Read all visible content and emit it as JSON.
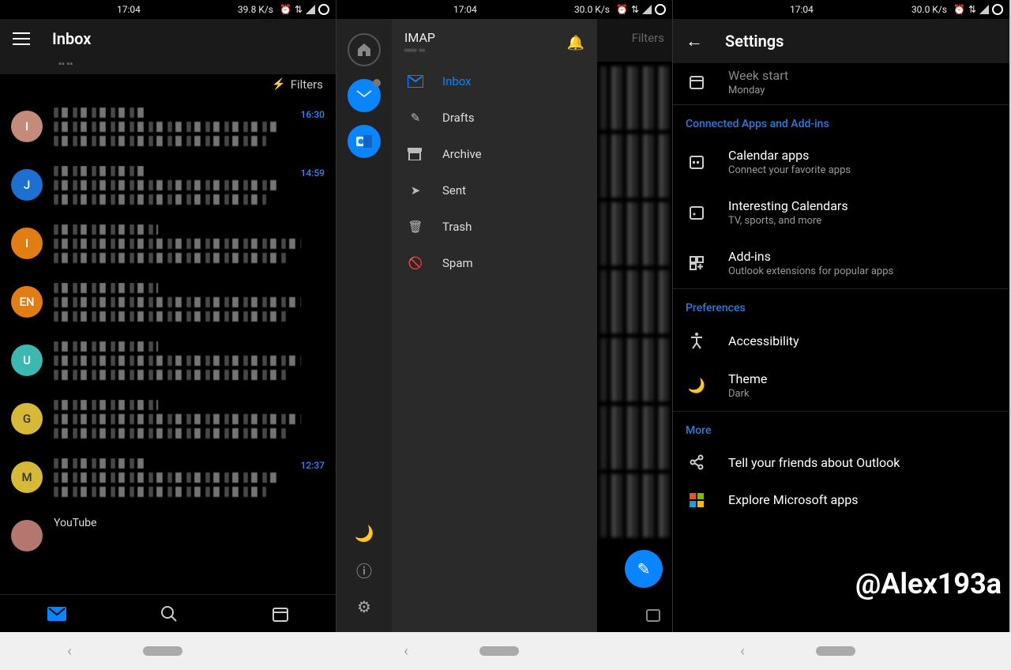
{
  "statusbars": [
    {
      "time": "17:04",
      "speed": "39.8 K/s"
    },
    {
      "time": "17:04",
      "speed": "30.0 K/s"
    },
    {
      "time": "17:04",
      "speed": "30.0 K/s"
    }
  ],
  "screen1": {
    "title": "Inbox",
    "filters_label": "Filters",
    "messages": [
      {
        "avatar": "I",
        "color": "#c48b7a",
        "time": "16:30"
      },
      {
        "avatar": "J",
        "color": "#1d6fd1",
        "time": "14:59"
      },
      {
        "avatar": "I",
        "color": "#e27d13",
        "time": ""
      },
      {
        "avatar": "EN",
        "color": "#e27d13",
        "time": ""
      },
      {
        "avatar": "U",
        "color": "#3db8b0",
        "time": ""
      },
      {
        "avatar": "G",
        "color": "#d6b936",
        "time": ""
      },
      {
        "avatar": "M",
        "color": "#d6b936",
        "time": "12:37"
      }
    ],
    "partial_sender": "YouTube"
  },
  "screen2": {
    "account_type": "IMAP",
    "nav": [
      {
        "icon": "inbox-icon",
        "label": "Inbox",
        "active": true
      },
      {
        "icon": "drafts-icon",
        "label": "Drafts"
      },
      {
        "icon": "archive-icon",
        "label": "Archive"
      },
      {
        "icon": "sent-icon",
        "label": "Sent"
      },
      {
        "icon": "trash-icon",
        "label": "Trash"
      },
      {
        "icon": "spam-icon",
        "label": "Spam"
      }
    ],
    "peek_filters": "Filters"
  },
  "screen3": {
    "title": "Settings",
    "week_start_label": "Week start",
    "week_start_value": "Monday",
    "section_connected": "Connected Apps and Add-ins",
    "connected": [
      {
        "label": "Calendar apps",
        "sub": "Connect your favorite apps"
      },
      {
        "label": "Interesting Calendars",
        "sub": "TV, sports, and more"
      },
      {
        "label": "Add-ins",
        "sub": "Outlook extensions for popular apps"
      }
    ],
    "section_prefs": "Preferences",
    "prefs": [
      {
        "label": "Accessibility",
        "sub": ""
      },
      {
        "label": "Theme",
        "sub": "Dark"
      }
    ],
    "section_more": "More",
    "more": [
      {
        "label": "Tell your friends about Outlook"
      },
      {
        "label": "Explore Microsoft apps"
      }
    ]
  },
  "watermark": "@Alex193a"
}
